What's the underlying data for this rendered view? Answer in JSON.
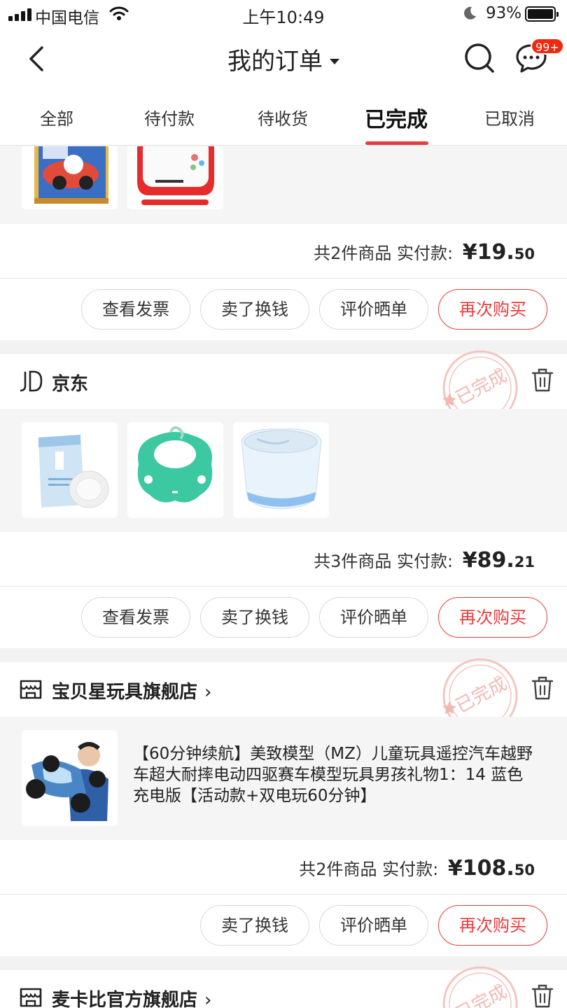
{
  "status_bar": {
    "carrier": "中国电信",
    "time": "上午10:49",
    "battery": "93%"
  },
  "nav": {
    "title": "我的订单",
    "badge": "99+"
  },
  "tabs": [
    {
      "label": "全部"
    },
    {
      "label": "待付款"
    },
    {
      "label": "待收货"
    },
    {
      "label": "已完成"
    },
    {
      "label": "已取消"
    }
  ],
  "active_tab": "已完成",
  "stamp_text": "已完成",
  "orders": [
    {
      "summary_count": "共2件商品",
      "summary_label": "实付款:",
      "price_main": "¥19.",
      "price_cents": "50",
      "buttons": [
        "查看发票",
        "卖了换钱",
        "评价晒单",
        "再次购买"
      ]
    },
    {
      "shop": "京东",
      "summary_count": "共3件商品",
      "summary_label": "实付款:",
      "price_main": "¥89.",
      "price_cents": "21",
      "buttons": [
        "查看发票",
        "卖了换钱",
        "评价晒单",
        "再次购买"
      ]
    },
    {
      "shop": "宝贝星玩具旗舰店",
      "product_title": "【60分钟续航】美致模型（MZ）儿童玩具遥控汽车越野车超大耐摔电动四驱赛车模型玩具男孩礼物1：14 蓝色充电版【活动款+双电玩60分钟】",
      "summary_count": "共2件商品",
      "summary_label": "实付款:",
      "price_main": "¥108.",
      "price_cents": "50",
      "buttons": [
        "卖了换钱",
        "评价晒单",
        "再次购买"
      ]
    },
    {
      "shop": "麦卡比官方旗舰店"
    }
  ],
  "colors": {
    "accent": "#e93b3d",
    "badge": "#f2270c",
    "stamp": "#f3c5c0"
  }
}
